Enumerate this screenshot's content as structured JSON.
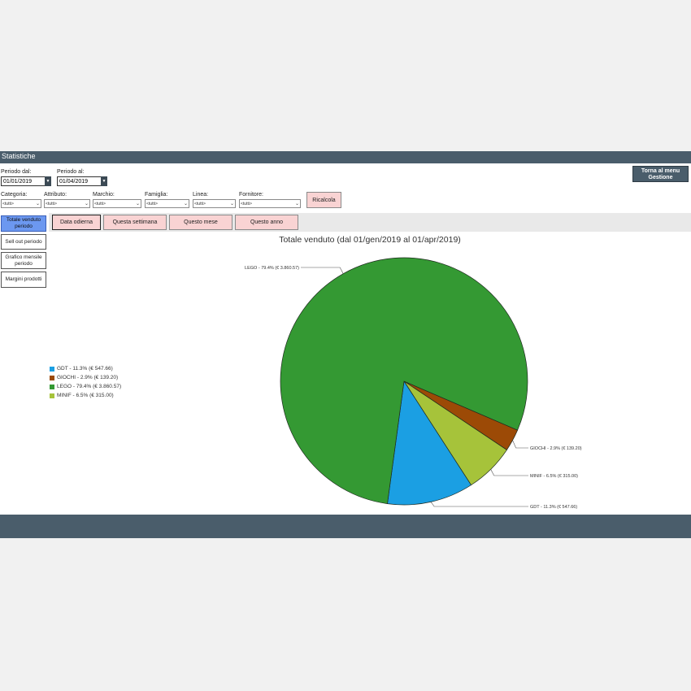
{
  "window": {
    "title": "Statistiche"
  },
  "header": {
    "back_button": "Torna al menu Gestione"
  },
  "filters": {
    "period_from_label": "Periodo dal:",
    "period_from_value": "01/01/2019",
    "period_to_label": "Periodo al:",
    "period_to_value": "01/04/2019",
    "categoria_label": "Categoria:",
    "attributo_label": "Attributo:",
    "marchio_label": "Marchio:",
    "famiglia_label": "Famiglia:",
    "linea_label": "Linea:",
    "fornitore_label": "Fornitore:",
    "combo_value": "<tutti>",
    "recalc_button": "Ricalcola"
  },
  "sidebar": {
    "items": [
      {
        "label": "Totale venduto periodo",
        "active": true
      },
      {
        "label": "Sell out periodo",
        "active": false
      },
      {
        "label": "Grafico mensile periodo",
        "active": false
      },
      {
        "label": "Margini prodotti",
        "active": false
      }
    ]
  },
  "quick_periods": [
    {
      "label": "Data odierna",
      "active": true
    },
    {
      "label": "Questa settimana",
      "active": false
    },
    {
      "label": "Questo mese",
      "active": false
    },
    {
      "label": "Questo anno",
      "active": false
    }
  ],
  "colors": {
    "GDT": "#1b9fe3",
    "GIOCHI": "#9c4a06",
    "LEGO": "#349933",
    "MINIF": "#a6c33a",
    "bar": "#4a5d6b",
    "active_side": "#6c98f0"
  },
  "chart_data": {
    "type": "pie",
    "title": "Totale venduto (dal 01/gen/2019 al 01/apr/2019)",
    "slices": [
      {
        "name": "GDT",
        "percent": 11.3,
        "value": 547.66,
        "label": "GDT - 11.3% (€ 547.66)",
        "callout": "GDT - 11.3% (€ 547.66)"
      },
      {
        "name": "GIOCHI",
        "percent": 2.9,
        "value": 139.2,
        "label": "GIOCHI - 2.9% (€ 139.20)",
        "callout": "GIOCHI - 2.9% (€ 139.20)"
      },
      {
        "name": "LEGO",
        "percent": 79.4,
        "value": 3860.57,
        "label": "LEGO - 79.4% (€ 3.860.57)",
        "callout": "LEGO - 79.4% (€ 3.860.57)"
      },
      {
        "name": "MINIF",
        "percent": 6.5,
        "value": 315.0,
        "label": "MINIF - 6.5% (€ 315.00)",
        "callout": "MINIF - 6.5% (€ 315.00)"
      }
    ],
    "legend_position": "left"
  }
}
